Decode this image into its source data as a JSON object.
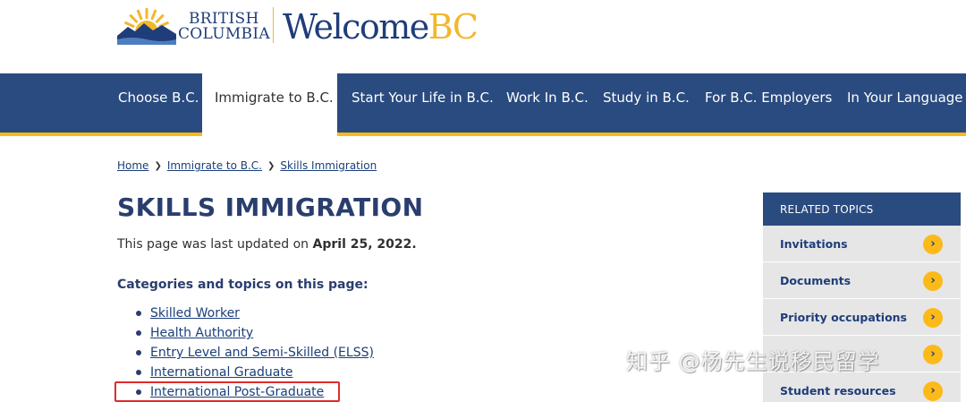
{
  "header": {
    "bc_logo_line1": "BRITISH",
    "bc_logo_line2": "COLUMBIA",
    "welcome_logo_part1": "Welcome",
    "welcome_logo_part2": "BC",
    "colors": {
      "navy": "#1f3d7a",
      "gold": "#f3b72b"
    }
  },
  "nav": {
    "items": [
      {
        "label": "Choose B.C."
      },
      {
        "label": "Immigrate to B.C.",
        "active": true
      },
      {
        "label": "Start Your Life in B.C."
      },
      {
        "label": "Work In B.C."
      },
      {
        "label": "Study in B.C."
      },
      {
        "label": "For B.C. Employers"
      },
      {
        "label": "In Your Language"
      }
    ],
    "colors": {
      "background": "#2a4b7f",
      "underline": "#fcba19"
    }
  },
  "breadcrumb": {
    "items": [
      "Home",
      "Immigrate to B.C.",
      "Skills Immigration"
    ],
    "separator_icon": "chevron-right-icon"
  },
  "page": {
    "title": "SKILLS IMMIGRATION",
    "updated_prefix": "This page was last updated on ",
    "updated_date": "April 25, 2022.",
    "categories_heading": "Categories and topics on this page:",
    "topics": [
      "Skilled Worker",
      "Health Authority",
      "Entry Level and Semi-Skilled (ELSS)",
      "International Graduate",
      "International Post-Graduate"
    ],
    "highlighted_topic": "International Post-Graduate",
    "highlight_color": "#e02b2b"
  },
  "related_topics": {
    "header": "RELATED TOPICS",
    "items": [
      {
        "label": "Invitations"
      },
      {
        "label": "Documents"
      },
      {
        "label": "Priority occupations"
      },
      {
        "label": ""
      },
      {
        "label": "Student resources"
      }
    ],
    "arrow_icon": "arrow-right-circle-icon",
    "arrow_color": "#fcba19"
  },
  "watermark": {
    "text": "知乎 @杨先生说移民留学"
  }
}
